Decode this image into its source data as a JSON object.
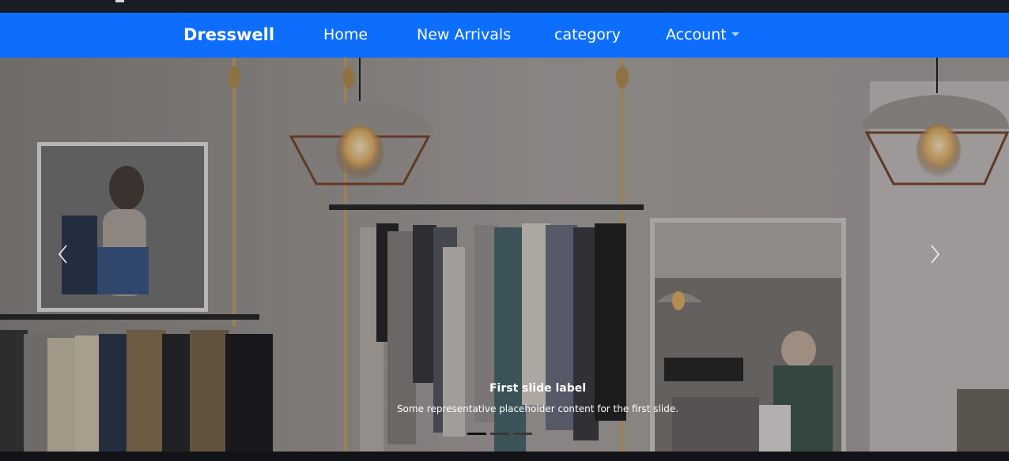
{
  "navbar": {
    "brand": "Dresswell",
    "links": [
      "Home",
      "New Arrivals",
      "category",
      "Account"
    ],
    "background": "#0d6efd"
  },
  "carousel": {
    "slide": {
      "title": "First slide label",
      "text": "Some representative placeholder content for the first slide."
    },
    "indicator_count": 3,
    "active_indicator": 0,
    "prev_icon": "chevron-left-icon",
    "next_icon": "chevron-right-icon"
  }
}
